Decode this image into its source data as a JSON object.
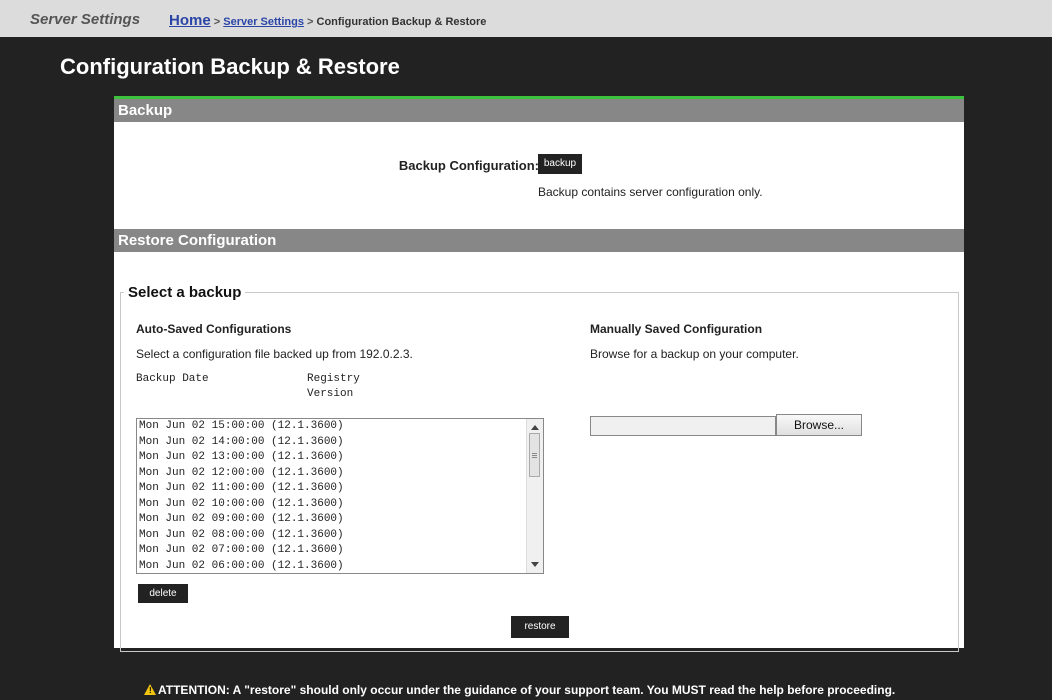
{
  "topbar": {
    "section_name": "Server Settings",
    "breadcrumb": {
      "home": "Home",
      "sep1": ">",
      "server_settings": "Server Settings",
      "sep2": ">",
      "current": "Configuration Backup & Restore"
    }
  },
  "page_title": "Configuration Backup & Restore",
  "backup": {
    "header": "Backup",
    "label": "Backup Configuration:",
    "button": "backup",
    "note": "Backup contains server configuration only."
  },
  "restore": {
    "header": "Restore Configuration",
    "legend": "Select a backup",
    "auto": {
      "title": "Auto-Saved Configurations",
      "description": "Select a configuration file backed up from 192.0.2.3.",
      "col_date": "Backup Date",
      "col_version_line1": "Registry",
      "col_version_line2": "Version",
      "items": [
        "Mon Jun 02 15:00:00 (12.1.3600)",
        "Mon Jun 02 14:00:00 (12.1.3600)",
        "Mon Jun 02 13:00:00 (12.1.3600)",
        "Mon Jun 02 12:00:00 (12.1.3600)",
        "Mon Jun 02 11:00:00 (12.1.3600)",
        "Mon Jun 02 10:00:00 (12.1.3600)",
        "Mon Jun 02 09:00:00 (12.1.3600)",
        "Mon Jun 02 08:00:00 (12.1.3600)",
        "Mon Jun 02 07:00:00 (12.1.3600)",
        "Mon Jun 02 06:00:00 (12.1.3600)"
      ],
      "delete_button": "delete"
    },
    "manual": {
      "title": "Manually Saved Configuration",
      "description": "Browse for a backup on your computer.",
      "file_value": "",
      "browse_button": "Browse..."
    },
    "restore_button": "restore"
  },
  "attention": "ATTENTION: A \"restore\" should only occur under the guidance of your support team. You MUST read the help before proceeding.",
  "colors": {
    "accent_green": "#3cc23c",
    "header_gray": "#878787",
    "link_blue": "#2b45a7",
    "background": "#222222",
    "warning_yellow": "#f1c40f"
  },
  "icons": [
    "warning-icon",
    "scroll-up-arrow-icon",
    "scroll-down-arrow-icon"
  ]
}
